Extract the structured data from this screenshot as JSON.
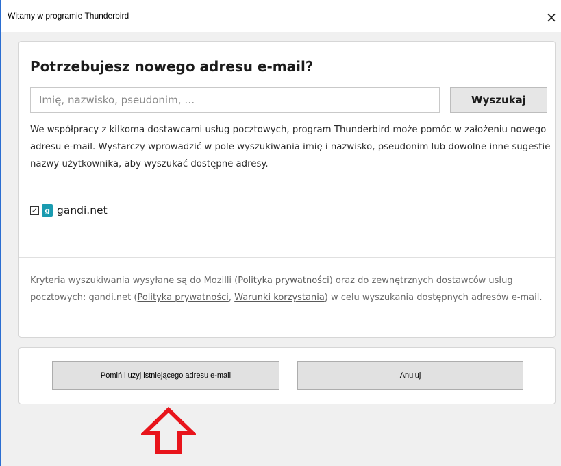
{
  "window": {
    "title": "Witamy w programie Thunderbird",
    "close_glyph": "×"
  },
  "main": {
    "heading": "Potrzebujesz nowego adresu e-mail?",
    "search": {
      "placeholder": "Imię, nazwisko, pseudonim, …",
      "value": "",
      "button_label": "Wyszukaj"
    },
    "description": "We współpracy z kilkoma dostawcami usług pocztowych, program Thunderbird może pomóc w założeniu nowego adresu e-mail. Wystarczy wprowadzić w pole wyszukiwania imię i nazwisko, pseudonim lub dowolne inne sugestie nazwy użytkownika, aby wyszukać dostępne adresy.",
    "provider": {
      "checked": true,
      "check_glyph": "✓",
      "logo_icon": "gandi-logo-icon",
      "logo_glyph": "g",
      "name": "gandi.net"
    },
    "privacy": {
      "part1": "Kryteria wyszukiwania wysyłane są do Mozilli (",
      "link1": "Polityka prywatności",
      "part2": ") oraz do zewnętrznych dostawców usług pocztowych: gandi.net (",
      "link2": "Polityka prywatności",
      "part3": ", ",
      "link3": "Warunki korzystania",
      "part4": ") w celu wyszukania dostępnych adresów e-mail."
    }
  },
  "footer": {
    "skip_label": "Pomiń i użyj istniejącego adresu e-mail",
    "cancel_label": "Anuluj"
  },
  "annotation": {
    "arrow_icon": "red-up-arrow-icon",
    "color": "#e8141b"
  }
}
